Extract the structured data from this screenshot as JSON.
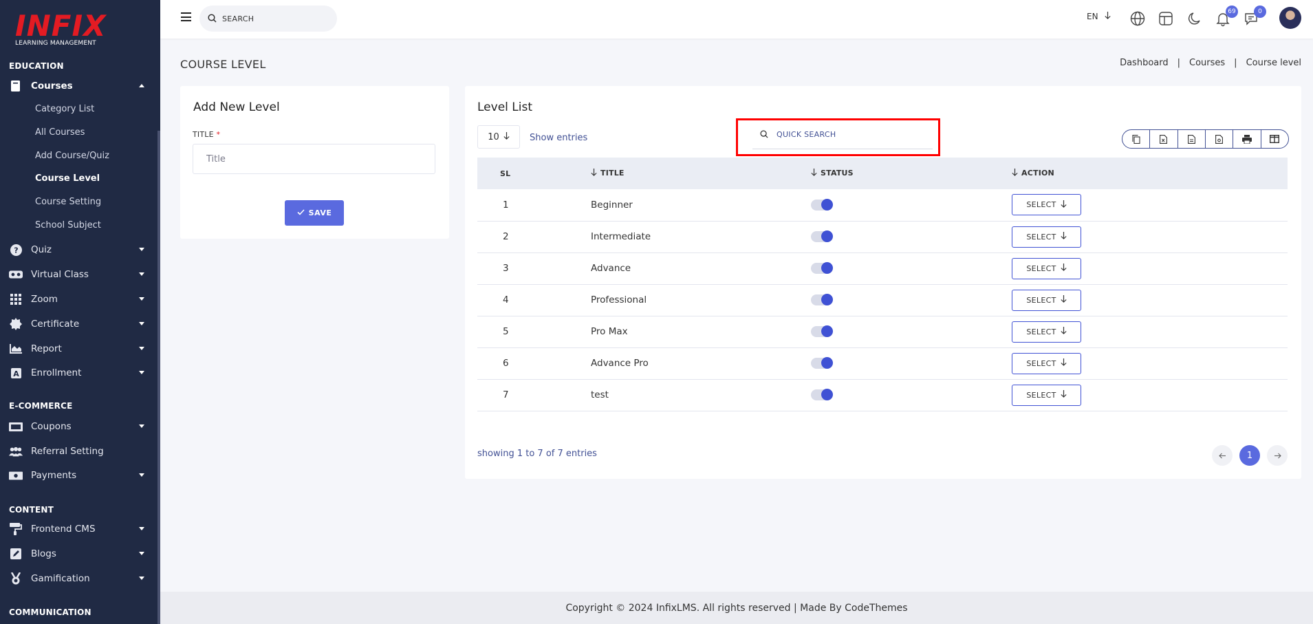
{
  "logo": {
    "mark": "INFIX",
    "sub": "LEARNING MANAGEMENT"
  },
  "sidebar": {
    "sections": {
      "education": "EDUCATION",
      "ecommerce": "E-COMMERCE",
      "content": "CONTENT",
      "communication": "COMMUNICATION"
    },
    "courses": "Courses",
    "course_sub": [
      "Category List",
      "All Courses",
      "Add Course/Quiz",
      "Course Level",
      "Course Setting",
      "School Subject"
    ],
    "items": [
      "Quiz",
      "Virtual Class",
      "Zoom",
      "Certificate",
      "Report",
      "Enrollment"
    ],
    "ecommerce_items": [
      "Coupons",
      "Referral Setting",
      "Payments"
    ],
    "content_items": [
      "Frontend CMS",
      "Blogs",
      "Gamification"
    ]
  },
  "topbar": {
    "search_placeholder": "SEARCH",
    "lang": "EN",
    "notification_count": "69",
    "message_count": "0"
  },
  "page": {
    "title": "COURSE LEVEL",
    "breadcrumb": [
      "Dashboard",
      "Courses",
      "Course level"
    ]
  },
  "form": {
    "title": "Add New Level",
    "label": "TITLE",
    "required_mark": "*",
    "placeholder": "Title",
    "save_label": "SAVE"
  },
  "list": {
    "title": "Level List",
    "entries_value": "10",
    "show_entries": "Show entries",
    "quick_search": "QUICK SEARCH",
    "columns": [
      "SL",
      "TITLE",
      "STATUS",
      "ACTION"
    ],
    "select_label": "SELECT",
    "rows": [
      {
        "sl": "1",
        "title": "Beginner",
        "status": true
      },
      {
        "sl": "2",
        "title": "Intermediate",
        "status": true
      },
      {
        "sl": "3",
        "title": "Advance",
        "status": true
      },
      {
        "sl": "4",
        "title": "Professional",
        "status": true
      },
      {
        "sl": "5",
        "title": "Pro Max",
        "status": true
      },
      {
        "sl": "6",
        "title": "Advance Pro",
        "status": true
      },
      {
        "sl": "7",
        "title": "test",
        "status": true
      }
    ],
    "showing": "showing 1 to 7 of 7 entries",
    "current_page": "1",
    "export_icons": [
      "copy-icon",
      "excel-icon",
      "csv-icon",
      "pdf-icon",
      "print-icon",
      "columns-icon"
    ]
  },
  "footer": {
    "text": "Copyright © 2024 InfixLMS. All rights reserved | Made By CodeThemes"
  },
  "colors": {
    "sidebar": "#202a44",
    "accent": "#5a6adf",
    "brand_red": "#e31b23",
    "text_link": "#415094",
    "highlight": "#ff0000"
  }
}
